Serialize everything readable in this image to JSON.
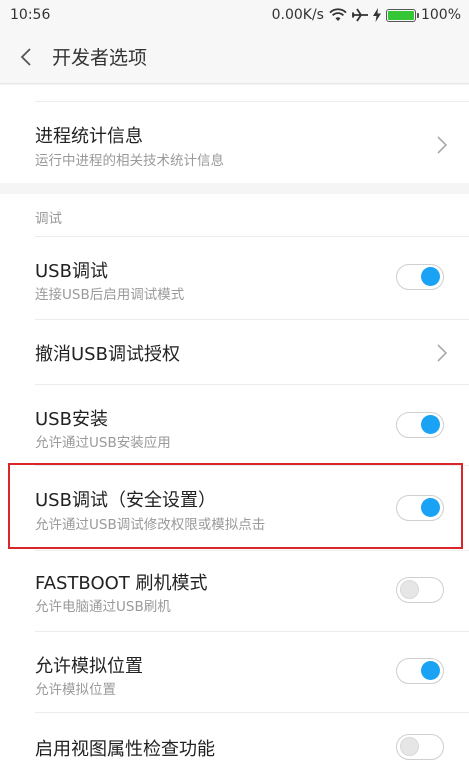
{
  "status_bar": {
    "time": "10:56",
    "network_speed": "0.00K/s",
    "battery": "100%",
    "battery_level": 1.0
  },
  "header": {
    "title": "开发者选项",
    "back_icon": "chevron-left-icon"
  },
  "process_stats": {
    "title": "进程统计信息",
    "subtitle": "运行中进程的相关技术统计信息"
  },
  "debug_section": {
    "label": "调试",
    "items": [
      {
        "title": "USB调试",
        "subtitle": "连接USB后启用调试模式",
        "control": "toggle",
        "on": true
      },
      {
        "title": "撤消USB调试授权",
        "subtitle": "",
        "control": "chevron"
      },
      {
        "title": "USB安装",
        "subtitle": "允许通过USB安装应用",
        "control": "toggle",
        "on": true
      },
      {
        "title": "USB调试（安全设置）",
        "subtitle": "允许通过USB调试修改权限或模拟点击",
        "control": "toggle",
        "on": true,
        "highlighted": true
      },
      {
        "title": "FASTBOOT 刷机模式",
        "subtitle": "允许电脑通过USB刷机",
        "control": "toggle",
        "on": false
      },
      {
        "title": "允许模拟位置",
        "subtitle": "允许模拟位置",
        "control": "toggle",
        "on": true
      },
      {
        "title": "启用视图属性检查功能",
        "subtitle": "",
        "control": "toggle",
        "on": false
      }
    ]
  },
  "colors": {
    "accent": "#1aa3f4",
    "highlight_border": "#d9262b",
    "battery": "#35c635"
  }
}
